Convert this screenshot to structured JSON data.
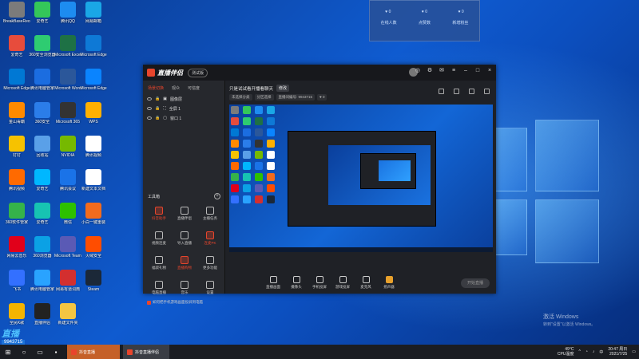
{
  "desktop": {
    "icons": [
      {
        "label": "BreakBaseRecovery",
        "color": "#7b7b7b"
      },
      {
        "label": "爱奇艺",
        "color": "#34c759"
      },
      {
        "label": "腾讯QQ",
        "color": "#1d8cf0"
      },
      {
        "label": "网易邮箱",
        "color": "#1aa7e6"
      },
      {
        "label": "爱奇艺",
        "color": "#e74c3c"
      },
      {
        "label": "360安全浏览器",
        "color": "#2ecc71"
      },
      {
        "label": "Microsoft Excel",
        "color": "#1e7145"
      },
      {
        "label": "Microsoft Edge",
        "color": "#0e79d6"
      },
      {
        "label": "Microsoft Edge",
        "color": "#0078d4"
      },
      {
        "label": "腾讯电脑管家",
        "color": "#1b6de0"
      },
      {
        "label": "Microsoft Word",
        "color": "#2b579a"
      },
      {
        "label": "Microsoft Edge",
        "color": "#0a84ff"
      },
      {
        "label": "金山毒霸",
        "color": "#ff8a00"
      },
      {
        "label": "360安全",
        "color": "#2b7de9"
      },
      {
        "label": "Microsoft 365",
        "color": "#333"
      },
      {
        "label": "WPS",
        "color": "#ffb000"
      },
      {
        "label": "钉钉",
        "color": "#f6c200"
      },
      {
        "label": "回收站",
        "color": "#5aa0e8"
      },
      {
        "label": "NVIDIA",
        "color": "#76b900"
      },
      {
        "label": "腾讯视频",
        "color": "#ffffff"
      },
      {
        "label": "腾讯视频",
        "color": "#ff6a00"
      },
      {
        "label": "爱奇艺",
        "color": "#00b7ff"
      },
      {
        "label": "腾讯会议",
        "color": "#1a73e8"
      },
      {
        "label": "新建文本文档",
        "color": "#ffffff"
      },
      {
        "label": "360软件管家",
        "color": "#35b34a"
      },
      {
        "label": "爱奇艺",
        "color": "#17c3b2"
      },
      {
        "label": "微信",
        "color": "#2dc100"
      },
      {
        "label": "小白一键重装",
        "color": "#f26b1d"
      },
      {
        "label": "网易云音乐",
        "color": "#e1001a"
      },
      {
        "label": "360浏览器",
        "color": "#0ba1e5"
      },
      {
        "label": "Microsoft Teams",
        "color": "#5a5ab5"
      },
      {
        "label": "火绒安全",
        "color": "#ff4d00"
      },
      {
        "label": "飞书",
        "color": "#3370ff"
      },
      {
        "label": "腾讯电脑管家",
        "color": "#29a3ff"
      },
      {
        "label": "网易有道词典",
        "color": "#d32f2f"
      },
      {
        "label": "Steam",
        "color": "#1b2838"
      },
      {
        "label": "全民K歌",
        "color": "#f4b400"
      },
      {
        "label": "直播伴侣",
        "color": "#222"
      },
      {
        "label": "新建文件夹",
        "color": "#f4c542"
      }
    ]
  },
  "overlay": {
    "row1": [
      "♥ 0",
      "♥ 0",
      "♥ 0"
    ],
    "row2": [
      "在线人数",
      "点赞数",
      "新增粉丝"
    ]
  },
  "app": {
    "title": "直播伴侣",
    "version": "测试版",
    "sidebar_tabs": [
      "场景切换",
      "观众",
      "可信度"
    ],
    "sources": [
      "图像层",
      "全屏 1",
      "窗口 1"
    ],
    "tools_title": "工具箱",
    "tools": [
      {
        "label": "抖音助手",
        "hot": true
      },
      {
        "label": "直播伴侣",
        "hot": false
      },
      {
        "label": "主播任务",
        "hot": false
      },
      {
        "label": "视频连麦",
        "hot": false
      },
      {
        "label": "导入直播",
        "hot": false
      },
      {
        "label": "连麦PK",
        "hot": true
      },
      {
        "label": "福袋礼物",
        "hot": false
      },
      {
        "label": "直播购物",
        "hot": true
      },
      {
        "label": "更多功能",
        "hot": false
      },
      {
        "label": "电脑直播",
        "hot": false
      },
      {
        "label": "音乐",
        "hot": false
      },
      {
        "label": "设置",
        "hot": false
      }
    ],
    "notice": "如何把手机游戏画面投屏到电脑",
    "topic_label": "只是试试看开播看聊天",
    "topic_button": "修改",
    "info_items": [
      "未选择分类",
      "分区选择",
      "直播间编号: 9943715",
      "♥ 0"
    ],
    "bottom_buttons": [
      "直播画面",
      "摄像头",
      "手机投屏",
      "游戏投屏",
      "麦克风",
      "扬声器"
    ],
    "start_button": "开始直播"
  },
  "watermark": {
    "line1": "激活 Windows",
    "line2": "转到\"设置\"以激活 Windows。"
  },
  "badge": {
    "logo": "直播",
    "id": "9943715"
  },
  "taskbar": {
    "apps": [
      "抖音直播",
      "抖音直播伴侣"
    ],
    "temp": "49°C",
    "cpu": "CPU温度",
    "time": "20:47 周日",
    "date": "2021/7/25"
  }
}
